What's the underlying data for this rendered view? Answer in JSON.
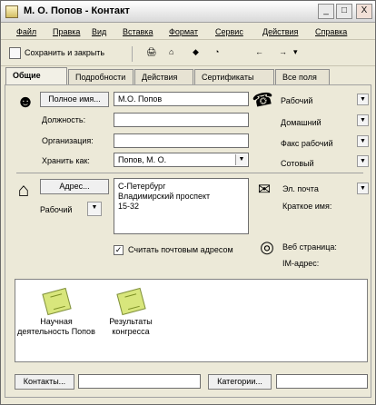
{
  "window": {
    "title": "М. О. Попов - Контакт",
    "controls": [
      "_",
      "□",
      "X"
    ]
  },
  "menu": [
    "Файл",
    "Правка",
    "Вид",
    "Вставка",
    "Формат",
    "Сервис",
    "Действия",
    "Справка"
  ],
  "toolbar": {
    "save_close": "Сохранить и закрыть",
    "symbols": [
      "🖨",
      "⌂",
      "◆",
      "◔",
      "←",
      "→",
      "▾"
    ]
  },
  "tabs": [
    "Общие",
    "Подробности",
    "Действия",
    "Сертификаты",
    "Все поля"
  ],
  "general": {
    "full_name_label": "Полное имя...",
    "full_name_value": "М.О. Попов",
    "position_label": "Должность:",
    "organization_label": "Организация:",
    "save_as_label": "Хранить как:",
    "save_as_value": "Попов, М. О."
  },
  "phones": [
    "Рабочий",
    "Домашний",
    "Факс рабочий",
    "Сотовый"
  ],
  "address": {
    "button": "Адрес...",
    "type": "Рабочий",
    "lines": [
      "С-Петербург",
      "Владимирский проспект",
      "15-32"
    ],
    "mailing_checkbox": "Считать почтовым адресом",
    "checked": true
  },
  "email": {
    "label": "Эл. почта",
    "short_name": "Краткое имя:",
    "web_page": "Веб страница:",
    "im": "IM-адрес:"
  },
  "attachments": [
    {
      "line1": "Научная",
      "line2": "деятельность Попов"
    },
    {
      "line1": "Результаты",
      "line2": "конгресса"
    }
  ],
  "footer": {
    "contacts_button": "Контакты...",
    "categories_button": "Категории..."
  }
}
